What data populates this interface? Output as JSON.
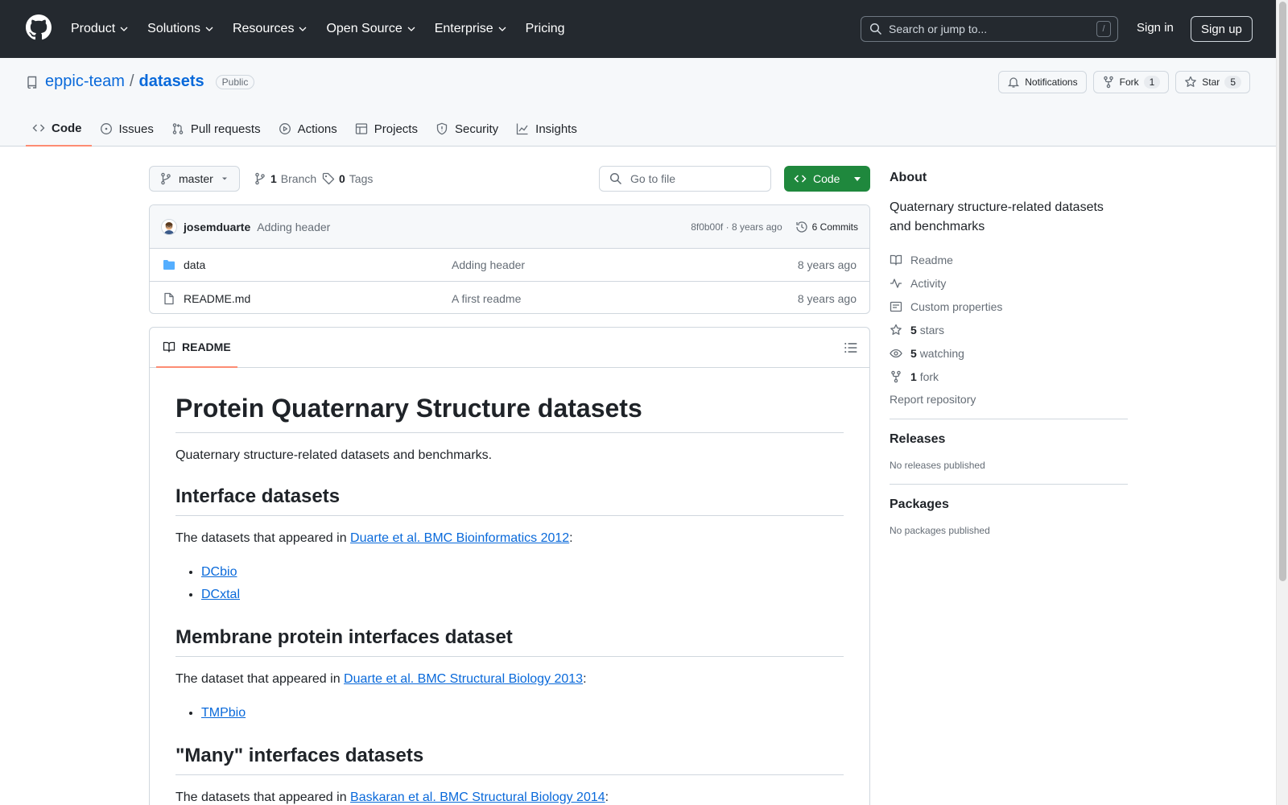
{
  "header": {
    "nav": [
      {
        "label": "Product",
        "has_dropdown": true
      },
      {
        "label": "Solutions",
        "has_dropdown": true
      },
      {
        "label": "Resources",
        "has_dropdown": true
      },
      {
        "label": "Open Source",
        "has_dropdown": true
      },
      {
        "label": "Enterprise",
        "has_dropdown": true
      },
      {
        "label": "Pricing",
        "has_dropdown": false
      }
    ],
    "search_placeholder": "Search or jump to...",
    "search_shortcut": "/",
    "sign_in": "Sign in",
    "sign_up": "Sign up"
  },
  "repo": {
    "owner": "eppic-team",
    "separator": "/",
    "name": "datasets",
    "visibility": "Public",
    "actions": {
      "notifications": "Notifications",
      "fork": "Fork",
      "fork_count": "1",
      "star": "Star",
      "star_count": "5"
    },
    "tabs": [
      {
        "label": "Code",
        "icon": "code-icon",
        "active": true
      },
      {
        "label": "Issues",
        "icon": "issue-icon",
        "active": false
      },
      {
        "label": "Pull requests",
        "icon": "pull-request-icon",
        "active": false
      },
      {
        "label": "Actions",
        "icon": "play-icon",
        "active": false
      },
      {
        "label": "Projects",
        "icon": "table-icon",
        "active": false
      },
      {
        "label": "Security",
        "icon": "shield-icon",
        "active": false
      },
      {
        "label": "Insights",
        "icon": "graph-icon",
        "active": false
      }
    ]
  },
  "browser": {
    "branch": "master",
    "branch_count": "1",
    "branch_label": "Branch",
    "tag_count": "0",
    "tag_label": "Tags",
    "goto_file": "Go to file",
    "code_button": "Code",
    "commit": {
      "author": "josemduarte",
      "message": "Adding header",
      "hash": "8f0b00f",
      "age": "8 years ago",
      "commits_label": "6 Commits"
    },
    "files": [
      {
        "name": "data",
        "type": "folder",
        "message": "Adding header",
        "age": "8 years ago"
      },
      {
        "name": "README.md",
        "type": "file",
        "message": "A first readme",
        "age": "8 years ago"
      }
    ]
  },
  "readme": {
    "tab_label": "README",
    "h1": "Protein Quaternary Structure datasets",
    "intro": "Quaternary structure-related datasets and benchmarks.",
    "sections": [
      {
        "heading": "Interface datasets",
        "text_before": "The datasets that appeared in ",
        "link": "Duarte et al. BMC Bioinformatics 2012",
        "text_after": ":",
        "items": [
          "DCbio",
          "DCxtal"
        ]
      },
      {
        "heading": "Membrane protein interfaces dataset",
        "text_before": "The dataset that appeared in ",
        "link": "Duarte et al. BMC Structural Biology 2013",
        "text_after": ":",
        "items": [
          "TMPbio"
        ]
      },
      {
        "heading": "\"Many\" interfaces datasets",
        "text_before": "The datasets that appeared in ",
        "link": "Baskaran et al. BMC Structural Biology 2014",
        "text_after": ":",
        "items": []
      }
    ]
  },
  "sidebar": {
    "about_heading": "About",
    "description": "Quaternary structure-related datasets and benchmarks",
    "items": [
      {
        "icon": "book-icon",
        "count": "",
        "label": "Readme"
      },
      {
        "icon": "pulse-icon",
        "count": "",
        "label": "Activity"
      },
      {
        "icon": "note-icon",
        "count": "",
        "label": "Custom properties"
      },
      {
        "icon": "star-icon",
        "count": "5",
        "label": "stars"
      },
      {
        "icon": "eye-icon",
        "count": "5",
        "label": "watching"
      },
      {
        "icon": "fork-icon",
        "count": "1",
        "label": "fork"
      }
    ],
    "report": "Report repository",
    "releases_heading": "Releases",
    "releases_note": "No releases published",
    "packages_heading": "Packages",
    "packages_note": "No packages published"
  },
  "colors": {
    "header_bg": "#24292f",
    "link": "#0969da",
    "code_button": "#1f883d",
    "active_tab_underline": "#fd8c73",
    "folder": "#54aeff"
  }
}
